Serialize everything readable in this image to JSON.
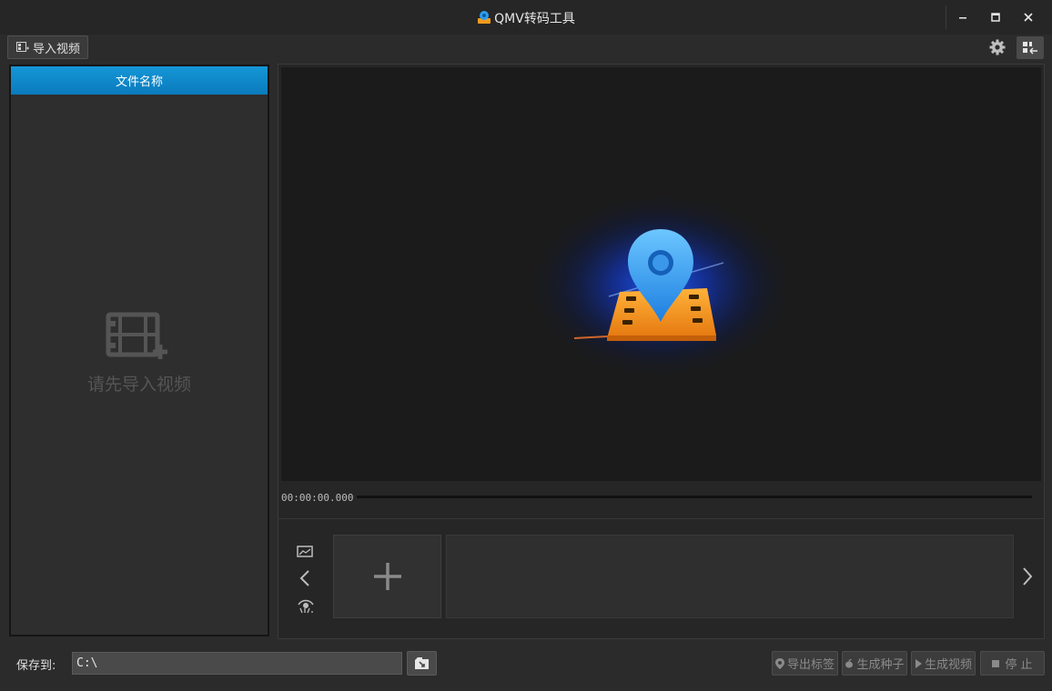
{
  "window": {
    "title": "QMV转码工具",
    "controls": {
      "minimize": "—",
      "maximize": "□",
      "close": "✕"
    }
  },
  "toolbar": {
    "import_label": "导入视频",
    "settings_icon": "gear-icon",
    "layout_icon": "layout-toggle-icon"
  },
  "file_list": {
    "header": "文件名称",
    "empty_text": "请先导入视频",
    "empty_icon": "film-add-icon"
  },
  "player": {
    "timecode": "00:00:00.000",
    "progress": 0
  },
  "thumbnails": {
    "add_icon": "plus-icon",
    "tools": [
      "image-icon",
      "chevron-left-icon",
      "eye-icon"
    ],
    "next_icon": "chevron-right-icon"
  },
  "footer": {
    "save_label": "保存到:",
    "save_path": "C:\\",
    "browse_icon": "folder-browse-icon",
    "buttons": {
      "export_tags": "导出标签",
      "generate_seed": "生成种子",
      "generate_video": "生成视频",
      "stop": "停 止"
    }
  },
  "colors": {
    "accent": "#0a8fd2",
    "background": "#2b2b2b",
    "preview_bg": "#1b1b1b",
    "logo_orange": "#f39a1f",
    "logo_blue": "#2d9cf0"
  }
}
